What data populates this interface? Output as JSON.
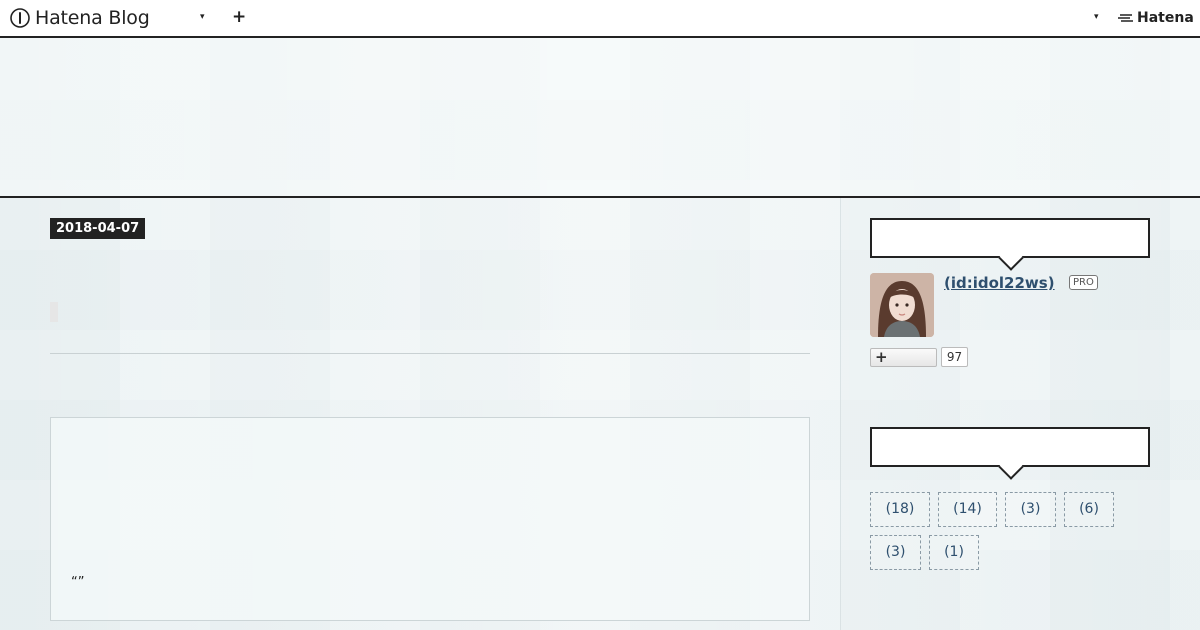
{
  "topbar": {
    "brand": "Hatena Blog",
    "dropdown_icon": "caret-down-icon",
    "plus_icon": "plus-icon",
    "hatena_logo": "Hatena"
  },
  "entry": {
    "date": "2018-04-07",
    "quote": "“”"
  },
  "profile": {
    "id_link": "(id:idol22ws)",
    "pro_badge": "PRO",
    "follow_icon": "plus-icon",
    "follower_count": "97"
  },
  "categories": [
    "(18)",
    "(14)",
    "(3)",
    "(6)",
    "(3)",
    "(1)"
  ],
  "colors": {
    "accent": "#222222",
    "link": "#2e4f6e",
    "background": "#eef4f5"
  }
}
